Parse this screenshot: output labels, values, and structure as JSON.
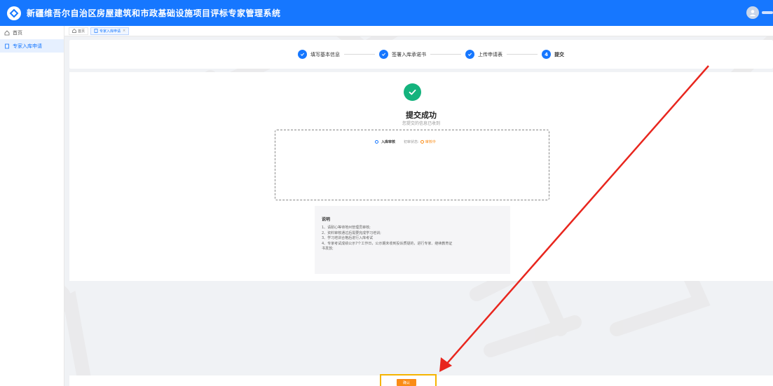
{
  "header": {
    "title": "新疆维吾尔自治区房屋建筑和市政基础设施项目评标专家管理系统"
  },
  "sidebar": {
    "items": [
      {
        "label": "首页",
        "icon": "home-icon"
      },
      {
        "label": "专家入库申请",
        "icon": "doc-icon"
      }
    ]
  },
  "tabs": [
    {
      "label": "首页",
      "icon": "home-icon"
    },
    {
      "label": "专家入库申请",
      "icon": "doc-icon",
      "close": "×"
    }
  ],
  "steps": [
    {
      "label": "填写基本信息",
      "state": "done"
    },
    {
      "label": "签署入库承诺书",
      "state": "done"
    },
    {
      "label": "上传申请表",
      "state": "done"
    },
    {
      "label": "提交",
      "number": "4",
      "state": "current"
    }
  ],
  "result": {
    "title": "提交成功",
    "subtitle": "您提交的信息已收到",
    "status_name": "入库审核",
    "status_key": "初审状态:",
    "status_value": "审核中"
  },
  "notes": {
    "title": "说明",
    "lines": [
      "1、请耐心等待地州管理员审核;",
      "2、资料审核通过后需要完成学习培训;",
      "3、学习培训合格后进行入库考试",
      "4、专家考试成绩公示7个工作日，公示期未收到投诉质疑的，进行专家、继续教育证",
      "书发放;"
    ]
  },
  "footer": {
    "confirm_label": "确认"
  },
  "colors": {
    "primary": "#1677ff",
    "success": "#14b37d",
    "warning": "#fa8c16",
    "annotation": "#e8261e",
    "highlight": "#f5b400"
  }
}
